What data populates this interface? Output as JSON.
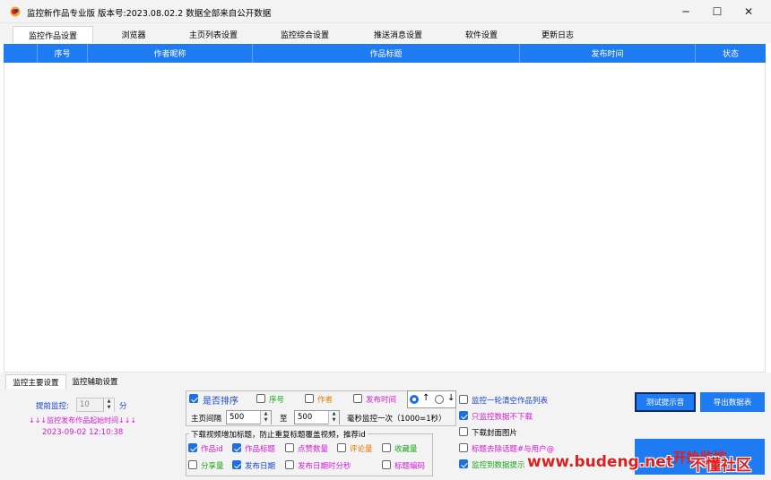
{
  "window": {
    "title": "监控新作品专业版 版本号:2023.08.02.2  数据全部来自公开数据",
    "minimize": "─",
    "maximize": "☐",
    "close": "✕"
  },
  "tabs": [
    "监控作品设置",
    "浏览器",
    "主页列表设置",
    "监控综合设置",
    "推送消息设置",
    "软件设置",
    "更新日志"
  ],
  "grid": {
    "columns": [
      "序号",
      "作者昵称",
      "作品标题",
      "发布时间",
      "状态"
    ],
    "rows": []
  },
  "bottom_tabs": [
    "监控主要设置",
    "监控辅助设置"
  ],
  "left": {
    "advance_label": "提前监控:",
    "advance_value": "10",
    "advance_unit": "分",
    "start_time_label": "↓↓↓监控发布作品起始时间↓↓↓",
    "start_time_value": "2023-09-02 12:10:38"
  },
  "sort": {
    "enable_label": "是否排序",
    "seq_label": "序号",
    "author_label": "作者",
    "pubtime_label": "发布时间",
    "up_label": "↑",
    "down_label": "↓"
  },
  "interval": {
    "label": "主页间隔",
    "from": "500",
    "to_label": "至",
    "to": "500",
    "suffix": "毫秒监控一次（1000=1秒）"
  },
  "download": {
    "legend": "下载视频增加标题，防止重复标题覆盖视频，推荐id",
    "options": [
      {
        "label": "作品id",
        "checked": true
      },
      {
        "label": "作品标题",
        "checked": true
      },
      {
        "label": "点赞数量",
        "checked": false
      },
      {
        "label": "评论量",
        "checked": false
      },
      {
        "label": "收藏量",
        "checked": false
      },
      {
        "label": "分享量",
        "checked": false
      },
      {
        "label": "发布日期",
        "checked": true
      },
      {
        "label": "发布日期时分秒",
        "checked": false
      },
      {
        "label": "标题编码",
        "checked": false
      }
    ]
  },
  "right_options": [
    {
      "label": "监控一轮清空作品列表",
      "checked": false
    },
    {
      "label": "只监控数据不下载",
      "checked": true
    },
    {
      "label": "下载封面图片",
      "checked": false
    },
    {
      "label": "标题去除话题#与用户@",
      "checked": false
    },
    {
      "label": "监控到数据提示",
      "checked": true
    }
  ],
  "buttons": {
    "test_sound": "测试提示音",
    "export": "导出数据表",
    "start": "开始监控"
  },
  "watermark": {
    "site": "www.budeng.net",
    "brand": "不懂社区"
  },
  "colors": {
    "accent": "#1e7bf2",
    "blue_text": "#1a44d6",
    "magenta_text": "#d61ad6",
    "orange_text": "#e07a00",
    "green_text": "#1aa61a"
  }
}
